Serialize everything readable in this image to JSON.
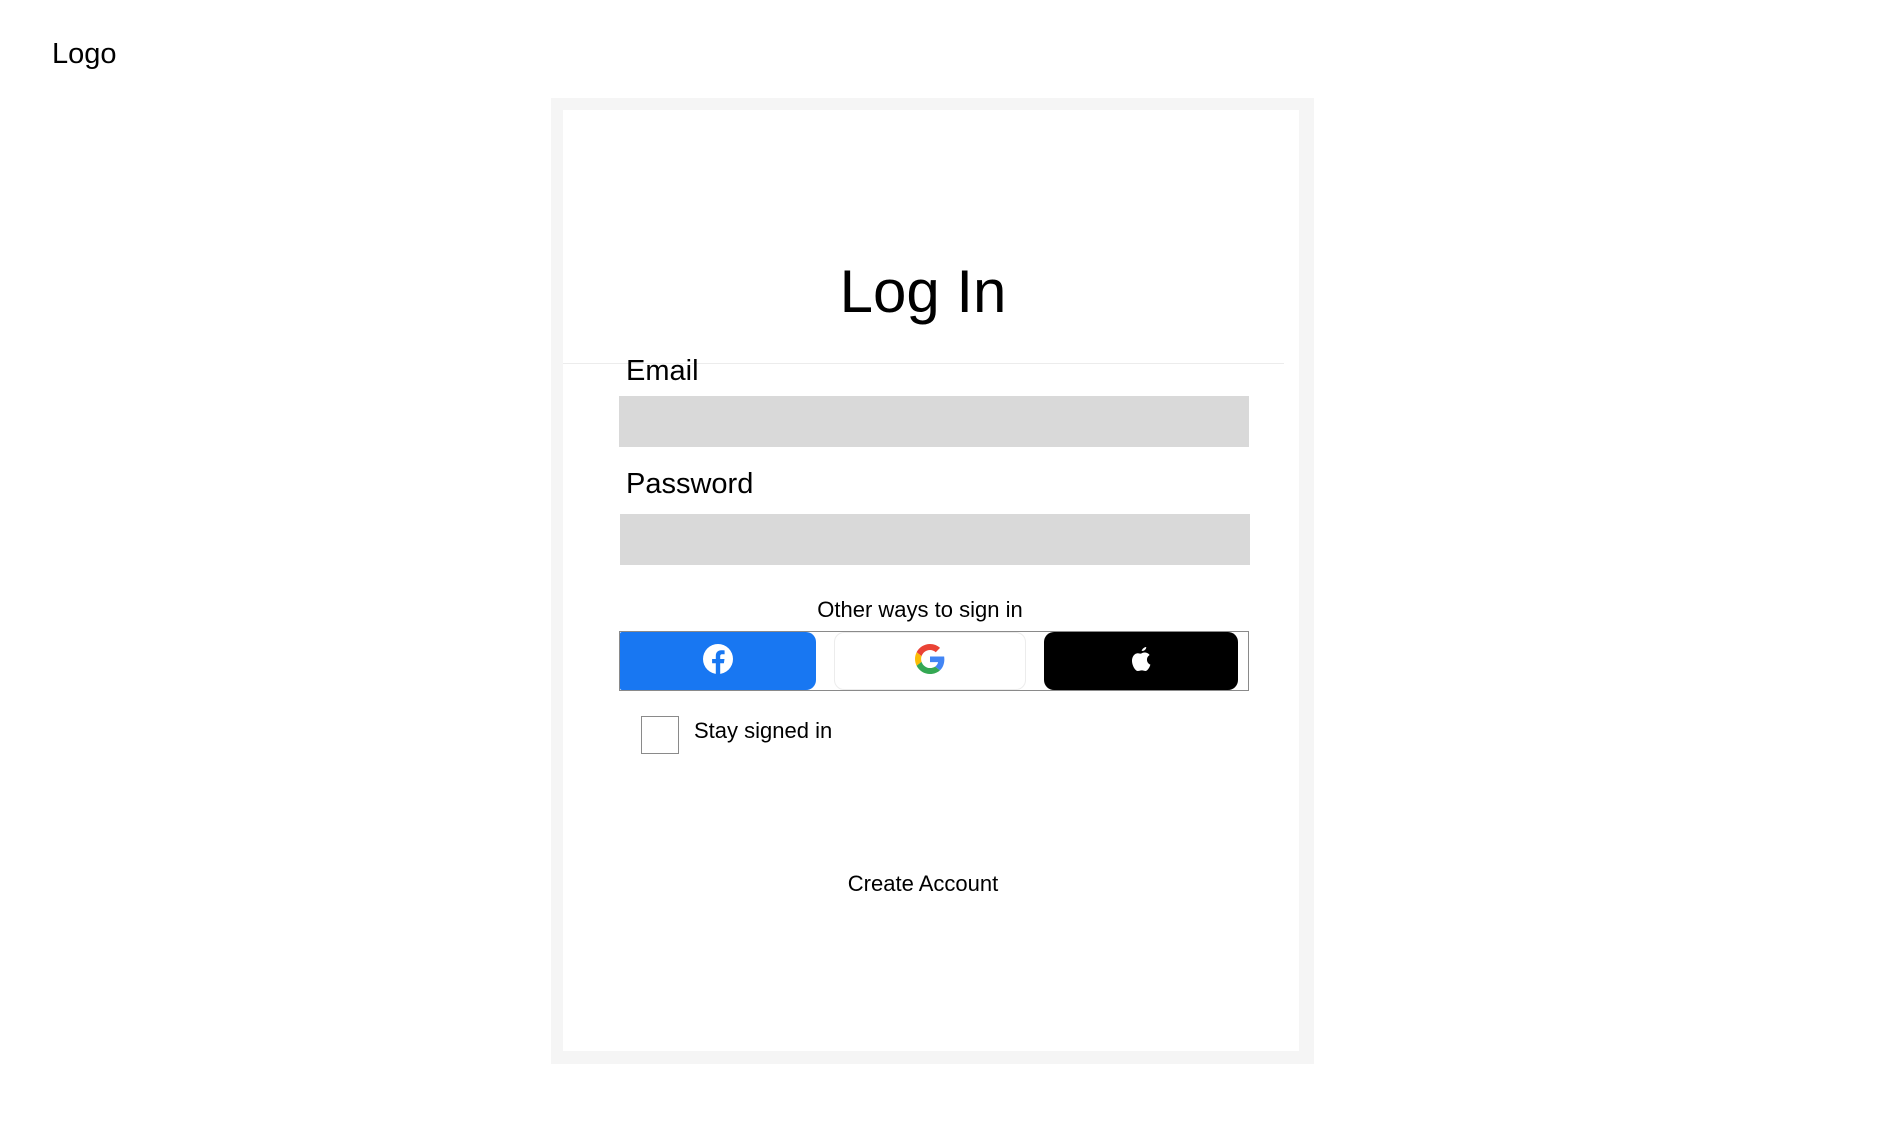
{
  "header": {
    "logo_text": "Logo"
  },
  "login": {
    "title": "Log In",
    "email": {
      "label": "Email",
      "value": "",
      "placeholder": ""
    },
    "password": {
      "label": "Password",
      "value": "",
      "placeholder": ""
    },
    "other_ways_text": "Other ways to sign in",
    "social_buttons": [
      {
        "provider": "facebook",
        "icon": "facebook-icon",
        "color": "#1877F2"
      },
      {
        "provider": "google",
        "icon": "google-icon",
        "color": "#FFFFFF"
      },
      {
        "provider": "apple",
        "icon": "apple-icon",
        "color": "#000000"
      }
    ],
    "stay_signed_in": {
      "label": "Stay signed in",
      "checked": false
    },
    "create_account_link": "Create Account"
  }
}
